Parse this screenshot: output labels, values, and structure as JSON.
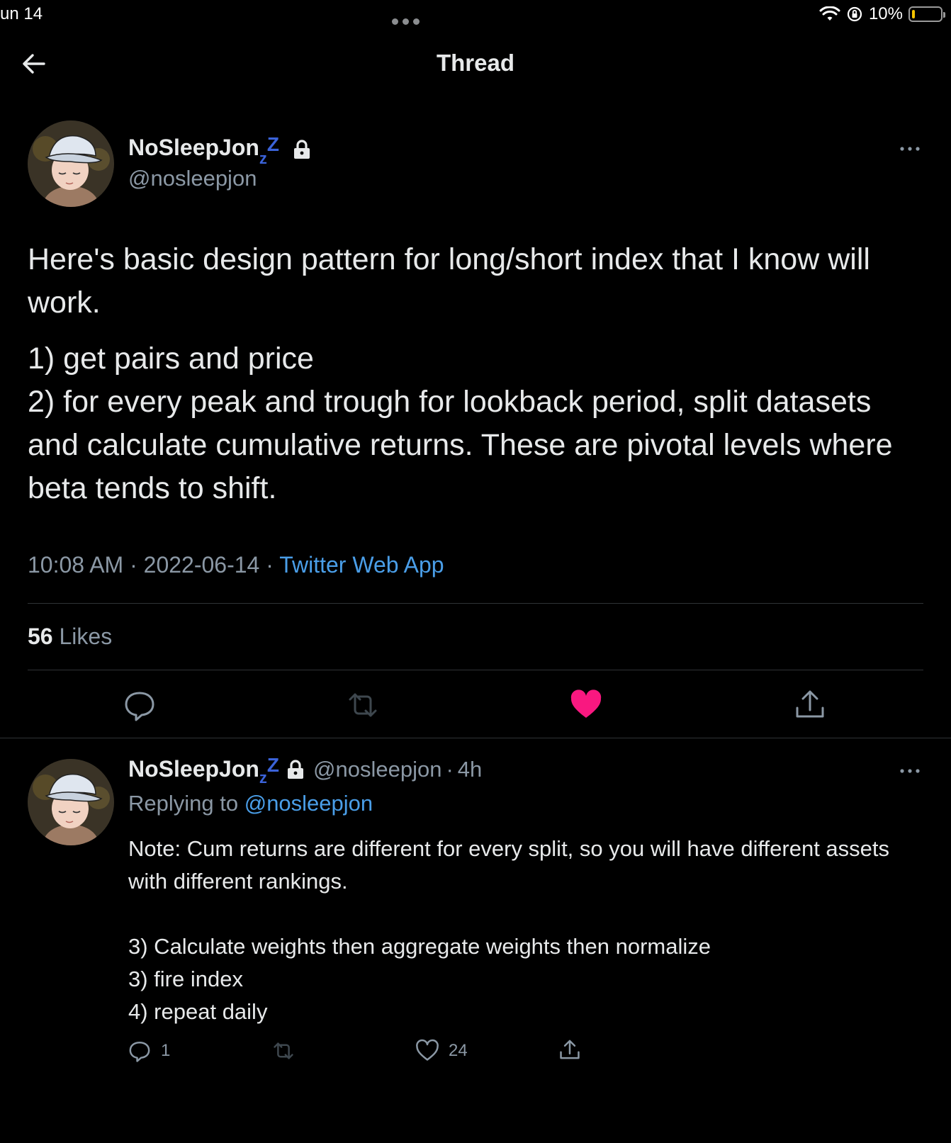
{
  "status_bar": {
    "time": "un 14",
    "battery": "10%",
    "battery_level": 0.1
  },
  "header": {
    "title": "Thread"
  },
  "main_tweet": {
    "display_name": "NoSleepJon",
    "name_suffix": "zZ",
    "handle": "@nosleepjon",
    "paragraph_1": "Here's basic design pattern for long/short index that I know will work.",
    "paragraph_2": "1) get pairs and price\n2) for every peak and trough for lookback period, split datasets and calculate cumulative returns. These are pivotal levels where beta tends to shift.",
    "time": "10:08 AM",
    "date": "2022-06-14",
    "separator": "·",
    "source": "Twitter Web App",
    "likes_count": "56",
    "likes_label": "Likes",
    "liked": true,
    "like_color": "#f91880"
  },
  "reply_tweet": {
    "display_name": "NoSleepJon",
    "name_suffix": "zZ",
    "handle": "@nosleepjon",
    "age": "4h",
    "replying_prefix": "Replying to",
    "replying_to": "@nosleepjon",
    "body": "Note: Cum returns are different for every split, so you will have different assets with different rankings.\n\n3) Calculate weights then aggregate weights then normalize\n3) fire index\n4) repeat daily",
    "reply_count": "1",
    "like_count": "24"
  },
  "colors": {
    "background": "#000000",
    "text": "#e7e9ea",
    "secondary": "#8b98a5",
    "link": "#4a9ee8",
    "like": "#f91880"
  }
}
